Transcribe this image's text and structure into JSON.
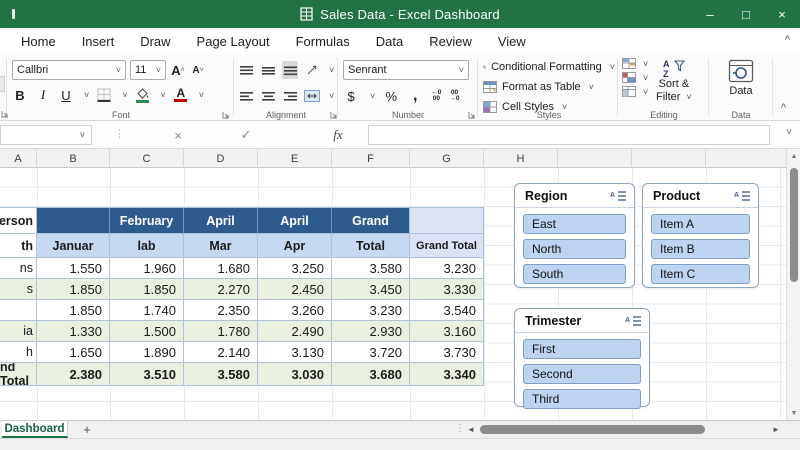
{
  "title_bar": {
    "title": "Sales Data - Excel Dashboard",
    "minimize": "–",
    "maximize": "□",
    "close": "×"
  },
  "ribbon": {
    "tabs": [
      "Home",
      "Insert",
      "Draw",
      "Page Layout",
      "Formulas",
      "Data",
      "Review",
      "View"
    ],
    "collapse_icon": "^",
    "font": {
      "label": "Font",
      "name": "Callbri",
      "size": "11",
      "bold": "B",
      "italic": "I",
      "underline": "U",
      "grow": "A",
      "shrink": "A"
    },
    "alignment": {
      "label": "Alignment"
    },
    "number": {
      "label": "Number",
      "format": "Senrant",
      "currency": "$",
      "percent": "%",
      "comma": ",",
      "inc_top": "←0",
      "inc_bot": "00",
      "dec_top": "00",
      "dec_bot": "→0"
    },
    "styles": {
      "label": "Styles",
      "items": [
        "Conditional Formatting",
        "Format as Table",
        "Cell Styles"
      ]
    },
    "editing": {
      "label": "Editing",
      "sort_line1": "Sort &",
      "sort_line2": "Filter"
    },
    "data_group": {
      "label": "Data",
      "button": "Data"
    }
  },
  "formula_bar": {
    "name_box": "",
    "cancel": "×",
    "enter": "✓",
    "fx": "fx",
    "formula": ""
  },
  "grid": {
    "column_headers": [
      "A",
      "B",
      "C",
      "D",
      "E",
      "F",
      "G",
      "H"
    ]
  },
  "table": {
    "header_row1": {
      "a": "sperson",
      "cols": [
        "",
        "February",
        "April",
        "April",
        "Grand"
      ],
      "g": ""
    },
    "header_row2": {
      "a": "th",
      "cols": [
        "Januar",
        "lab",
        "Mar",
        "Apr",
        "Total"
      ],
      "g": "Grand Total"
    },
    "rows": [
      {
        "a": "ns",
        "cells": [
          "1.550",
          "1.960",
          "1.680",
          "3.250",
          "3.580",
          "3.230"
        ]
      },
      {
        "a": "s",
        "cells": [
          "1.850",
          "1.850",
          "2.270",
          "2.450",
          "3.450",
          "3.330"
        ]
      },
      {
        "a": "",
        "cells": [
          "1.850",
          "1.740",
          "2.350",
          "3.260",
          "3.230",
          "3.540"
        ]
      },
      {
        "a": "ia",
        "cells": [
          "1.330",
          "1.500",
          "1.780",
          "2.490",
          "2.930",
          "3.160"
        ]
      },
      {
        "a": "h",
        "cells": [
          "1.650",
          "1.890",
          "2.140",
          "3.130",
          "3.720",
          "3.730"
        ]
      }
    ],
    "total": {
      "a": "nd Total",
      "cells": [
        "2.380",
        "3.510",
        "3.580",
        "3.030",
        "3.680",
        "3.340"
      ]
    }
  },
  "slicers": [
    {
      "title": "Region",
      "items": [
        "East",
        "North",
        "South"
      ]
    },
    {
      "title": "Product",
      "items": [
        "Item A",
        "Item B",
        "Item C"
      ]
    },
    {
      "title": "Trimester",
      "items": [
        "First",
        "Second",
        "Third"
      ]
    }
  ],
  "sheet_tabs": {
    "active": "Dashboard",
    "add": "+"
  },
  "colors": {
    "excel_green": "#217346",
    "header_blue": "#2E5B8E",
    "subheader_blue": "#C7D9F0",
    "grand_col_blue": "#DAE2F3",
    "band_green": "#E9F0DF",
    "slicer_fill": "#BED3EF",
    "slicer_border": "#7E9EC9"
  }
}
